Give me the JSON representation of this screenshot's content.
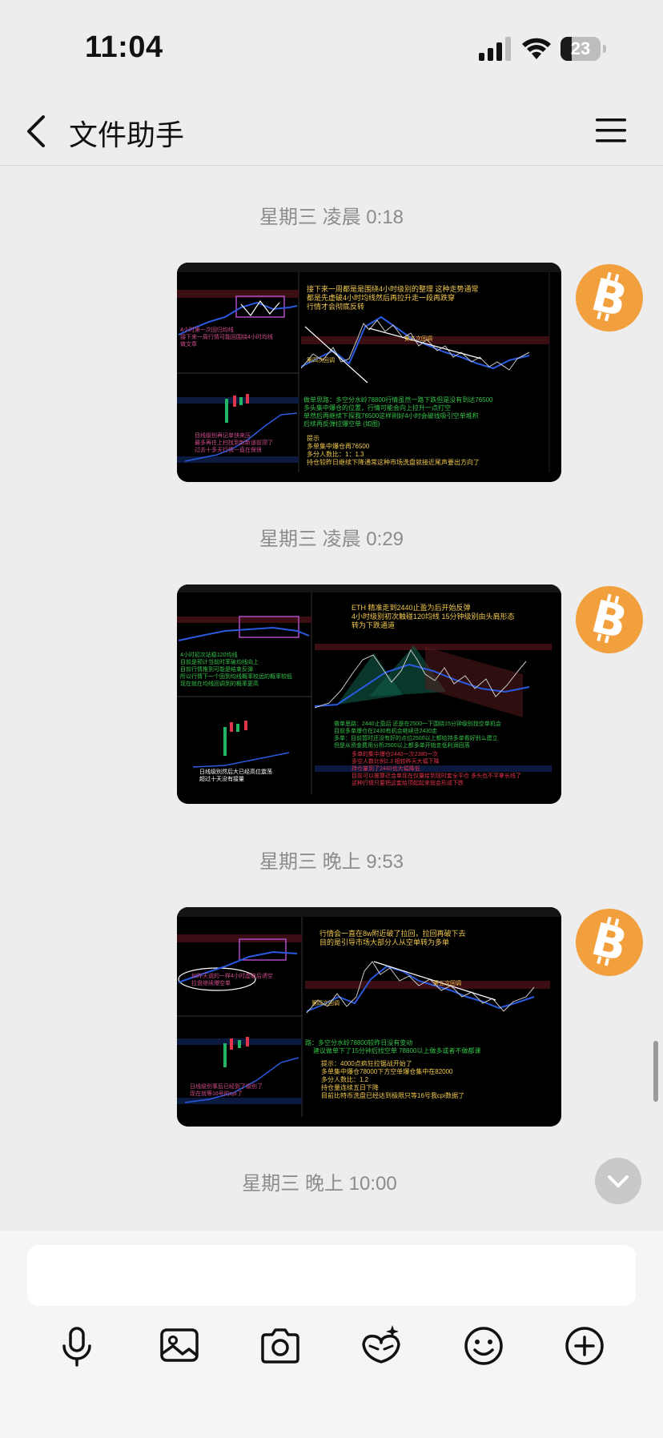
{
  "status_bar": {
    "time": "11:04",
    "battery": "23"
  },
  "nav": {
    "title": "文件助手"
  },
  "messages": [
    {
      "time": "星期三 凌晨 0:18",
      "image": {
        "left_top_text": [
          "4小时第一次回归均线",
          "接下来一周行情可能回围绕4小时均线",
          "做文章"
        ],
        "left_bottom_text": [
          "目线级别再记单快来压",
          "最多再往上扫找到新新道前顶了",
          "过去十多天行情一直在保很"
        ],
        "main_title": [
          "接下来一周都是是围绕4小时级别的整理 这种走势通常",
          "都是先虚破4小时均线然后再拉升走一段再跌穿",
          "行情才会彻底反转"
        ],
        "main_labels": [
          "第四次回调",
          "第五次回调"
        ],
        "notes_green": [
          "做单思路：多空分水岭78800行情虽然一路下跌但是没有到达76500",
          "多头集中爆仓的位置，行情可能会向上拉升一点打空",
          "单然后再继续下探我76500这样刚好4小时会破线吸引空单堆积",
          "后续再反弹拉爆空单 (如图)"
        ],
        "notes_yellow": [
          "提示",
          "多单集中爆仓再76500",
          "多分人数比：1：1.3",
          "持仓较昨日继续下降通常这种市场洗盘就接近尾声要出方向了"
        ]
      }
    },
    {
      "time": "星期三 凌晨 0:29",
      "image": {
        "left_top_text": [
          "4小时初次站稳120均线",
          "目前是预计当前时率破均线向上",
          "目前行情推到可能是结束反弹",
          "所以行情下一个回到均线概率较远的概率较低",
          "现在就在均线回调到的概率更高"
        ],
        "left_bottom_text": [
          "日线级别然后大已经高位震荡",
          "超过十天没有接量"
        ],
        "main_title": [
          "ETH 精准走到2440止盈为后开始反弹",
          "4小时级别初次触碰120均线 15分钟级别由头肩形态",
          "转为下跌通道"
        ],
        "main_labels": [],
        "notes_green": [
          "做单思路：2440止盈后 还是在2500一下围绕15分钟级别找空单机会",
          "目前多单爆仓在2430有机会继续往2430走",
          "多单：目前暂时还没有好的点位2500以上都给持多单看好别么建立",
          "但是从资金费用分析2500以上都多单开始走低利润回落"
        ],
        "notes_yellow": [
          "多单的集中爆仓2440一次2380一次",
          "多空人数比例2.3 相较昨天大幅下降",
          "持仓量到了2440也大幅降低",
          "目前可以推算近合单现在仅量给到现时套全平仓 多头也不平拿长线了",
          "这种行情只要把这套给顶起起来就会形成下跌"
        ]
      }
    },
    {
      "time": "星期三 晚上 9:53",
      "image": {
        "left_top_text": [
          "如昨天说的一样4小时虚破后诱空",
          "拉盘继续爆空单"
        ],
        "left_bottom_text": [
          "日线级别事后已经到了级别了",
          "现在就等16号的cpi了"
        ],
        "main_title": [
          "行情会一直在8w附近破了拉回，拉回再破下去",
          "目的是引导市场大部分人从空单转为多单"
        ],
        "main_labels": [
          "第四次回调",
          "第五次回调"
        ],
        "notes_green": [
          "路：多空分水岭78800较昨日没有变动",
          "建议做单下了15分钟后找空单 78800以上做多或者不做都课"
        ],
        "notes_yellow": [
          "提示：4000点疯狂拉锯战开始了",
          "多单集中爆仓78000下方空单爆仓集中在82000",
          "多分人数比：1.2",
          "持仓量连续五日下降",
          "目前比特币洗盘已经达到极限只等16号我cpi数据了"
        ]
      }
    }
  ],
  "last_timestamp": "星期三 晚上 10:00",
  "input": {
    "placeholder": ""
  },
  "toolbar": [
    "microphone",
    "image",
    "camera",
    "ai-assistant",
    "emoji",
    "more"
  ],
  "colors": {
    "background": "#ededed",
    "bitcoin_orange": "#f2a03d",
    "chart_bg": "#000000"
  }
}
